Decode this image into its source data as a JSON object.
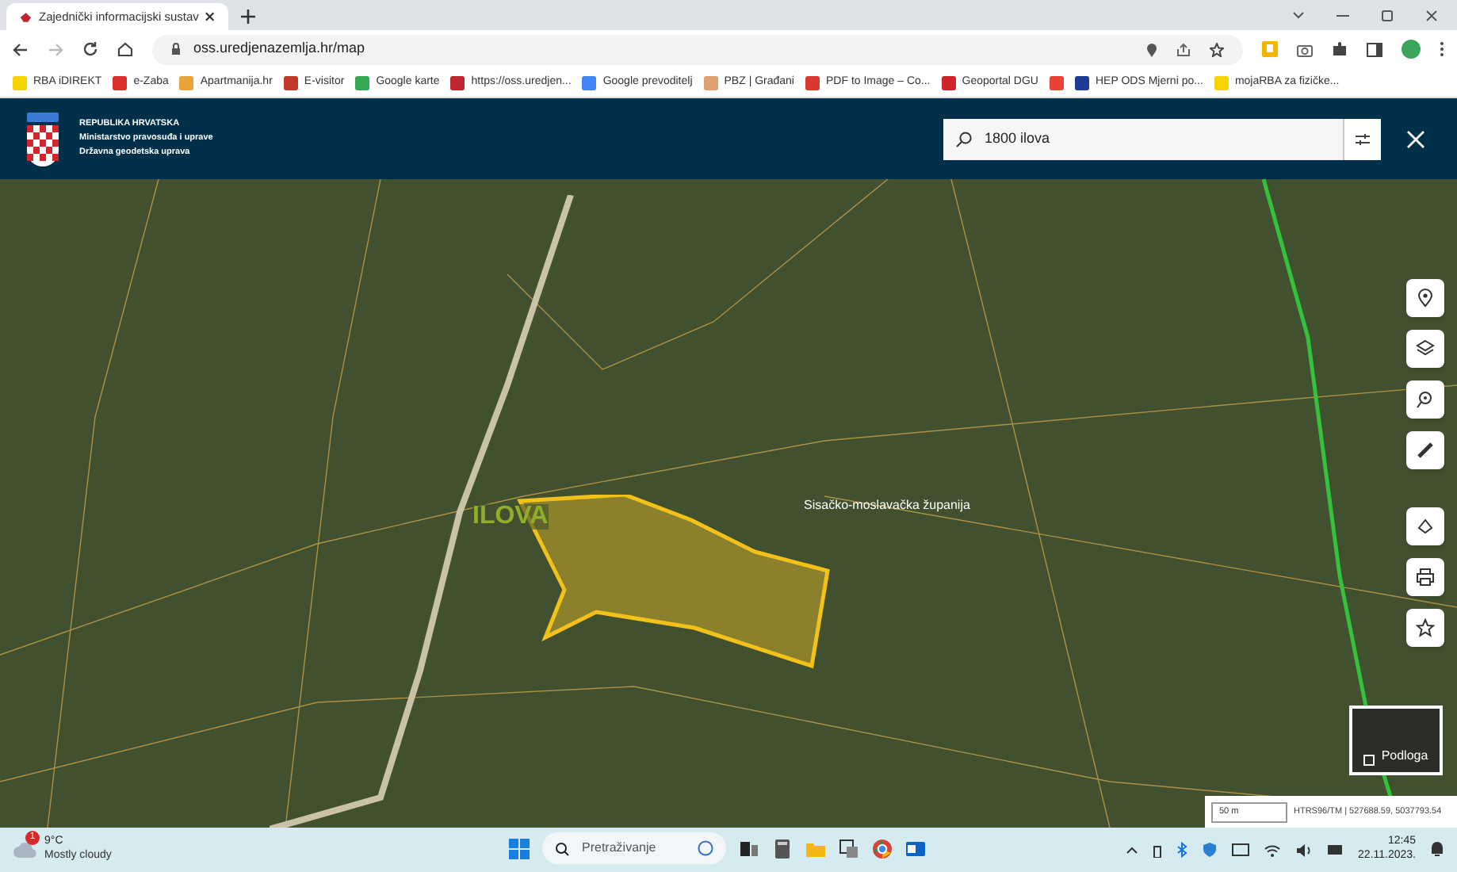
{
  "browser": {
    "tab": {
      "title": "Zajednički informacijski sustav",
      "selected": true
    },
    "address": "oss.uredjenazemlja.hr/map",
    "bookmarks": [
      {
        "label": "RBA iDIREKT",
        "color": "#f5d300"
      },
      {
        "label": "e-Zaba",
        "color": "#d9302c"
      },
      {
        "label": "Apartmanija.hr",
        "color": "#e8a33a"
      },
      {
        "label": "E-visitor",
        "color": "#c0392b"
      },
      {
        "label": "Google karte",
        "color": "#34a853"
      },
      {
        "label": "https://oss.uredjen...",
        "color": "#c0262d"
      },
      {
        "label": "Google prevoditelj",
        "color": "#4285f4"
      },
      {
        "label": "PBZ | Građani",
        "color": "#e0a070"
      },
      {
        "label": "PDF to Image – Co...",
        "color": "#d63a2f"
      },
      {
        "label": "Geoportal DGU",
        "color": "#d0222a"
      },
      {
        "color": "#ea4335"
      },
      {
        "label": "HEP ODS Mjerni po...",
        "color": "#1e3c96"
      },
      {
        "label": "mojaRBA za fizičke...",
        "color": "#f5d300"
      }
    ]
  },
  "header": {
    "org_lines": [
      "REPUBLIKA HRVATSKA",
      "Ministarstvo pravosuđa i uprave",
      "Državna geodetska uprava"
    ],
    "search": {
      "value": "1800 ilova"
    }
  },
  "map": {
    "labels": [
      {
        "text": "ILOVA",
        "kind": "place"
      },
      {
        "text": "Sisačko-moslavačka županija",
        "kind": "region"
      }
    ],
    "basemap": {
      "label": "Podloga"
    },
    "scale": "50 m",
    "coordinates": "HTRS96/TM | 527688.59, 5037793.54"
  },
  "taskbar": {
    "weather": {
      "temp": "9°C",
      "desc": "Mostly cloudy",
      "badge": "1"
    },
    "search_placeholder": "Pretraživanje",
    "time": "12:45",
    "date": "22.11.2023."
  }
}
